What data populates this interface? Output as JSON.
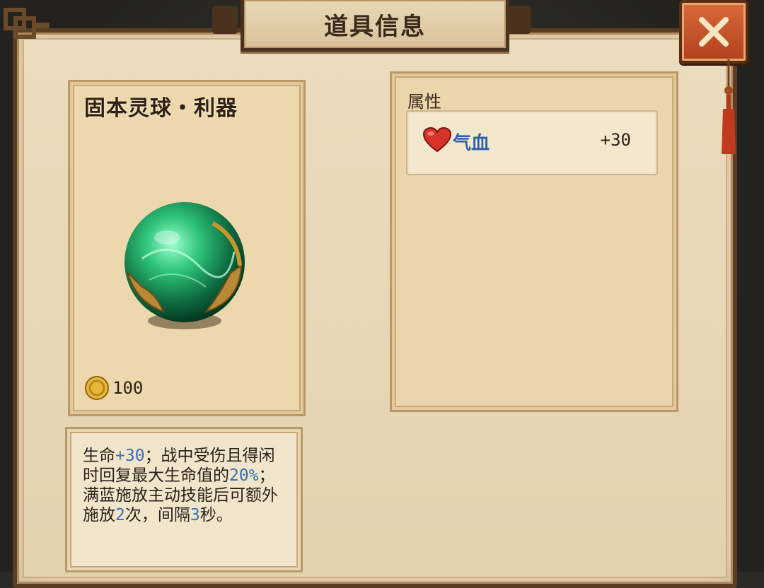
{
  "dialog": {
    "title": "道具信息"
  },
  "item": {
    "name": "固本灵球・利器",
    "price": "100",
    "icon": "green-orb-icon",
    "description_parts": [
      {
        "text": "生命",
        "hl": false
      },
      {
        "text": "+30",
        "hl": true
      },
      {
        "text": "；战中受伤且得闲时回复最大生命值的",
        "hl": false
      },
      {
        "text": "20%",
        "hl": true
      },
      {
        "text": "；满蓝施放主动技能后可额外施放",
        "hl": false
      },
      {
        "text": "2",
        "hl": true
      },
      {
        "text": "次，间隔",
        "hl": false
      },
      {
        "text": "3",
        "hl": true
      },
      {
        "text": "秒。",
        "hl": false
      }
    ]
  },
  "attributes": {
    "heading": "属性",
    "rows": [
      {
        "icon": "heart-icon",
        "name": "气血",
        "value": "+30"
      }
    ]
  },
  "colors": {
    "highlight": "#3a6fb5",
    "attr_name": "#2d5fb0",
    "close_button": "#c4532a"
  }
}
